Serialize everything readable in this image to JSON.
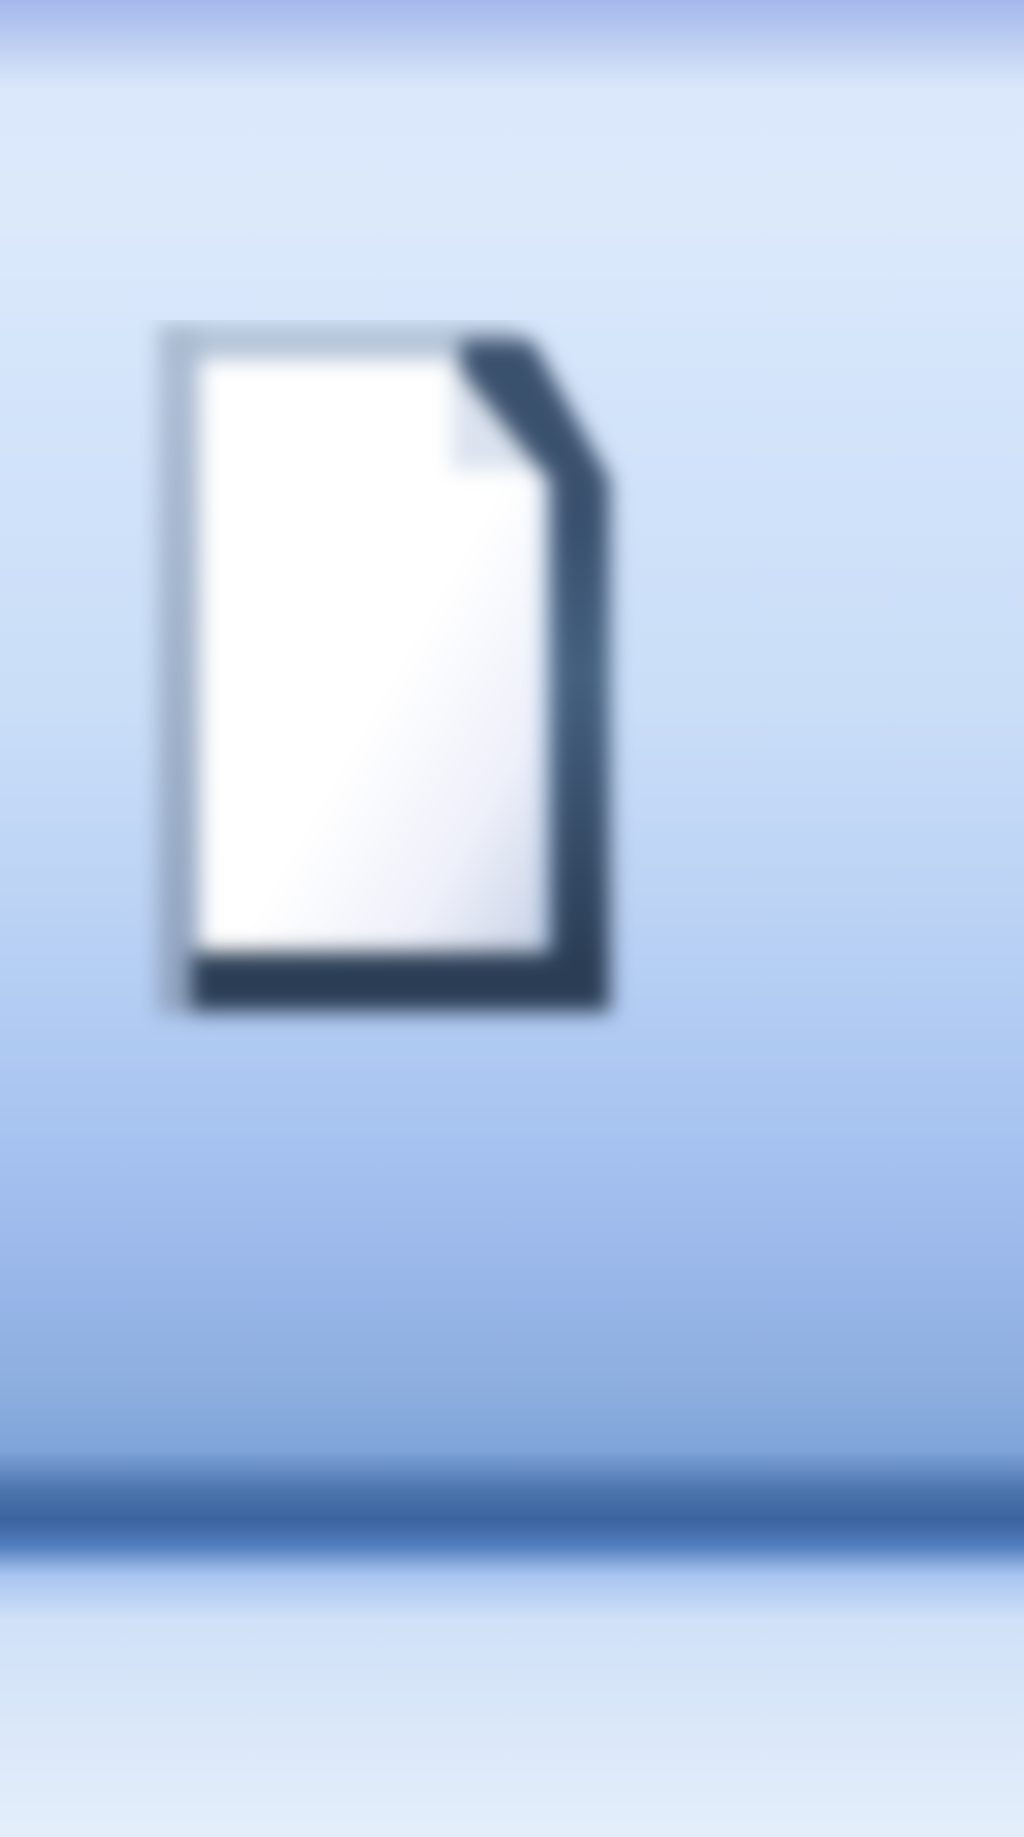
{
  "toolbar": {
    "buttons": [
      {
        "icon": "new-document-icon",
        "label": ""
      }
    ]
  },
  "colors": {
    "bar_top": "#dbe8fb",
    "bar_mid": "#aac6f1",
    "divider_line": "#3b649f",
    "page_fill": "#ffffff",
    "page_outline": "#2f4763"
  }
}
